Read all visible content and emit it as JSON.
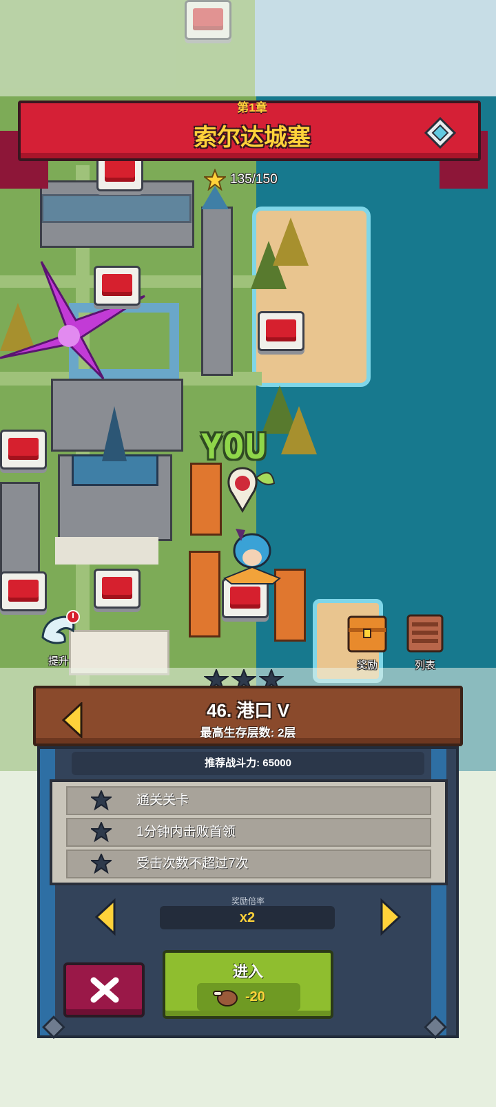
{
  "header": {
    "chapter_label": "第1章",
    "chapter_title": "索尔达城塞",
    "stars_progress": "135/150"
  },
  "map": {
    "player_marker": "YOU",
    "side_buttons": [
      {
        "label": "提升",
        "icon": "upgrade-wing-icon"
      },
      {
        "label": "奖励",
        "icon": "treasure-chest-icon"
      },
      {
        "label": "列表",
        "icon": "list-icon"
      }
    ]
  },
  "stage": {
    "earned_stars": 0,
    "total_stars": 3,
    "title": "46. 港口 V",
    "best_survival": "最高生存层数: 2层",
    "recommended_power": "推荐战斗力: 65000",
    "objectives": [
      {
        "text": "通关关卡",
        "completed": false
      },
      {
        "text": "1分钟内击败首领",
        "completed": false
      },
      {
        "text": "受击次数不超过7次",
        "completed": false
      }
    ],
    "reward_multiplier_label": "奖励倍率",
    "reward_multiplier": "x2",
    "enter_label": "进入",
    "cost": "-20",
    "cost_icon": "stamina-meat-icon"
  },
  "colors": {
    "banner_red": "#d52036",
    "gold_text": "#ffd23a",
    "sea": "#17798e",
    "enter_green": "#8fbe2f",
    "close_crimson": "#9a1848"
  }
}
